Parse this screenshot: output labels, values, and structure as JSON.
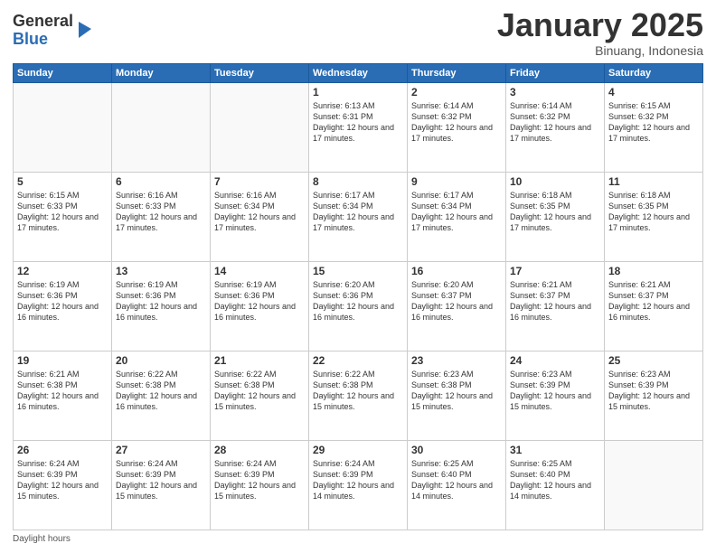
{
  "header": {
    "logo_general": "General",
    "logo_blue": "Blue",
    "month_title": "January 2025",
    "subtitle": "Binuang, Indonesia"
  },
  "footer": {
    "label": "Daylight hours"
  },
  "weekdays": [
    "Sunday",
    "Monday",
    "Tuesday",
    "Wednesday",
    "Thursday",
    "Friday",
    "Saturday"
  ],
  "weeks": [
    [
      {
        "day": "",
        "info": ""
      },
      {
        "day": "",
        "info": ""
      },
      {
        "day": "",
        "info": ""
      },
      {
        "day": "1",
        "info": "Sunrise: 6:13 AM\nSunset: 6:31 PM\nDaylight: 12 hours\nand 17 minutes."
      },
      {
        "day": "2",
        "info": "Sunrise: 6:14 AM\nSunset: 6:32 PM\nDaylight: 12 hours\nand 17 minutes."
      },
      {
        "day": "3",
        "info": "Sunrise: 6:14 AM\nSunset: 6:32 PM\nDaylight: 12 hours\nand 17 minutes."
      },
      {
        "day": "4",
        "info": "Sunrise: 6:15 AM\nSunset: 6:32 PM\nDaylight: 12 hours\nand 17 minutes."
      }
    ],
    [
      {
        "day": "5",
        "info": "Sunrise: 6:15 AM\nSunset: 6:33 PM\nDaylight: 12 hours\nand 17 minutes."
      },
      {
        "day": "6",
        "info": "Sunrise: 6:16 AM\nSunset: 6:33 PM\nDaylight: 12 hours\nand 17 minutes."
      },
      {
        "day": "7",
        "info": "Sunrise: 6:16 AM\nSunset: 6:34 PM\nDaylight: 12 hours\nand 17 minutes."
      },
      {
        "day": "8",
        "info": "Sunrise: 6:17 AM\nSunset: 6:34 PM\nDaylight: 12 hours\nand 17 minutes."
      },
      {
        "day": "9",
        "info": "Sunrise: 6:17 AM\nSunset: 6:34 PM\nDaylight: 12 hours\nand 17 minutes."
      },
      {
        "day": "10",
        "info": "Sunrise: 6:18 AM\nSunset: 6:35 PM\nDaylight: 12 hours\nand 17 minutes."
      },
      {
        "day": "11",
        "info": "Sunrise: 6:18 AM\nSunset: 6:35 PM\nDaylight: 12 hours\nand 17 minutes."
      }
    ],
    [
      {
        "day": "12",
        "info": "Sunrise: 6:19 AM\nSunset: 6:36 PM\nDaylight: 12 hours\nand 16 minutes."
      },
      {
        "day": "13",
        "info": "Sunrise: 6:19 AM\nSunset: 6:36 PM\nDaylight: 12 hours\nand 16 minutes."
      },
      {
        "day": "14",
        "info": "Sunrise: 6:19 AM\nSunset: 6:36 PM\nDaylight: 12 hours\nand 16 minutes."
      },
      {
        "day": "15",
        "info": "Sunrise: 6:20 AM\nSunset: 6:36 PM\nDaylight: 12 hours\nand 16 minutes."
      },
      {
        "day": "16",
        "info": "Sunrise: 6:20 AM\nSunset: 6:37 PM\nDaylight: 12 hours\nand 16 minutes."
      },
      {
        "day": "17",
        "info": "Sunrise: 6:21 AM\nSunset: 6:37 PM\nDaylight: 12 hours\nand 16 minutes."
      },
      {
        "day": "18",
        "info": "Sunrise: 6:21 AM\nSunset: 6:37 PM\nDaylight: 12 hours\nand 16 minutes."
      }
    ],
    [
      {
        "day": "19",
        "info": "Sunrise: 6:21 AM\nSunset: 6:38 PM\nDaylight: 12 hours\nand 16 minutes."
      },
      {
        "day": "20",
        "info": "Sunrise: 6:22 AM\nSunset: 6:38 PM\nDaylight: 12 hours\nand 16 minutes."
      },
      {
        "day": "21",
        "info": "Sunrise: 6:22 AM\nSunset: 6:38 PM\nDaylight: 12 hours\nand 15 minutes."
      },
      {
        "day": "22",
        "info": "Sunrise: 6:22 AM\nSunset: 6:38 PM\nDaylight: 12 hours\nand 15 minutes."
      },
      {
        "day": "23",
        "info": "Sunrise: 6:23 AM\nSunset: 6:38 PM\nDaylight: 12 hours\nand 15 minutes."
      },
      {
        "day": "24",
        "info": "Sunrise: 6:23 AM\nSunset: 6:39 PM\nDaylight: 12 hours\nand 15 minutes."
      },
      {
        "day": "25",
        "info": "Sunrise: 6:23 AM\nSunset: 6:39 PM\nDaylight: 12 hours\nand 15 minutes."
      }
    ],
    [
      {
        "day": "26",
        "info": "Sunrise: 6:24 AM\nSunset: 6:39 PM\nDaylight: 12 hours\nand 15 minutes."
      },
      {
        "day": "27",
        "info": "Sunrise: 6:24 AM\nSunset: 6:39 PM\nDaylight: 12 hours\nand 15 minutes."
      },
      {
        "day": "28",
        "info": "Sunrise: 6:24 AM\nSunset: 6:39 PM\nDaylight: 12 hours\nand 15 minutes."
      },
      {
        "day": "29",
        "info": "Sunrise: 6:24 AM\nSunset: 6:39 PM\nDaylight: 12 hours\nand 14 minutes."
      },
      {
        "day": "30",
        "info": "Sunrise: 6:25 AM\nSunset: 6:40 PM\nDaylight: 12 hours\nand 14 minutes."
      },
      {
        "day": "31",
        "info": "Sunrise: 6:25 AM\nSunset: 6:40 PM\nDaylight: 12 hours\nand 14 minutes."
      },
      {
        "day": "",
        "info": ""
      }
    ]
  ]
}
